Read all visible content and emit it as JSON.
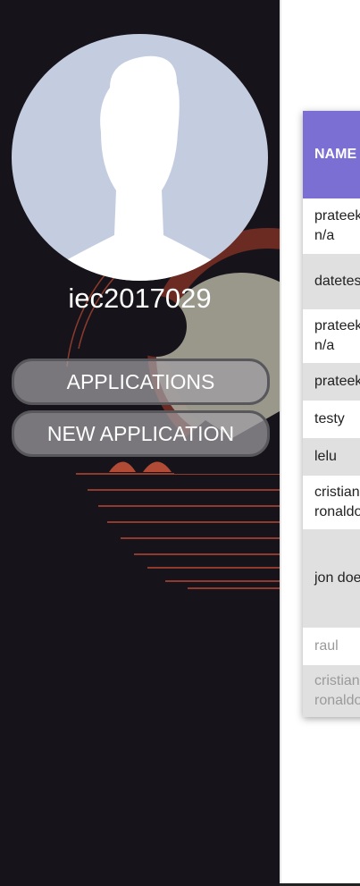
{
  "user": {
    "username": "iec2017029"
  },
  "nav": {
    "applications_label": "APPLICATIONS",
    "new_application_label": "NEW APPLICATION"
  },
  "table": {
    "header": "NAME",
    "rows": [
      {
        "line1": "prateek",
        "line2": "n/a"
      },
      {
        "line1": "datetest",
        "line2": ""
      },
      {
        "line1": "prateek",
        "line2": "n/a"
      },
      {
        "line1": "prateek",
        "line2": ""
      },
      {
        "line1": "testy",
        "line2": ""
      },
      {
        "line1": "lelu",
        "line2": ""
      },
      {
        "line1": "cristiano",
        "line2": "ronaldo"
      },
      {
        "line1": "jon doe",
        "line2": ""
      },
      {
        "line1": "raul",
        "line2": ""
      },
      {
        "line1": "cristiano",
        "line2": "ronaldo"
      }
    ]
  },
  "colors": {
    "sidebar_bg": "#16141a",
    "table_header_bg": "#7b6fd3",
    "alt_row_bg": "#e0e0e0",
    "avatar_bg": "#c4cde0"
  }
}
